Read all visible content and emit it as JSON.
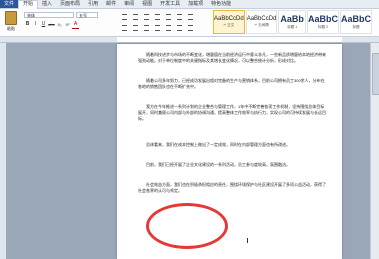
{
  "menu": {
    "file_label": "文件",
    "tabs": [
      "开始",
      "插入",
      "页面布局",
      "引用",
      "邮件",
      "审阅",
      "视图",
      "开发工具",
      "加载项",
      "特色功能"
    ]
  },
  "clipboard": {
    "paste_label": "粘贴"
  },
  "font": {
    "name": "宋体",
    "size": "五号",
    "buttons": [
      "B",
      "I",
      "U",
      "abc",
      "X₂",
      "X²",
      "A"
    ]
  },
  "styles": [
    {
      "sample": "AaBbCcDd",
      "name": "↵ 正文",
      "selected": true,
      "big": false
    },
    {
      "sample": "AaBbCcDd",
      "name": "↵ 无间隔",
      "selected": false,
      "big": false
    },
    {
      "sample": "AaBb",
      "name": "标题 1",
      "selected": false,
      "big": true
    },
    {
      "sample": "AaBbC",
      "name": "标题 2",
      "selected": false,
      "big": true
    },
    {
      "sample": "AaBbC",
      "name": "标题",
      "selected": false,
      "big": true
    }
  ],
  "document": {
    "paragraphs": [
      "随着科技进步与市场的不断变化，增量值在当前经济运行中意义非凡，一些新品质增量给本地经济带来强劲动能。对于单位制度中的关键指标及其增长变化情况，可以整合统计分析，形成对比。",
      "随着公司多年努力，已经成功发展出相对完备的生产与营销体系，目前公司拥有员工300余人，分布在各地的销售团队也在不断扩充中。",
      "我方在今年推进一系列计划的企业整合与管理工作，1年中不断完善各项工作机制，坚持围绕总体目标展开，同时兼顾公司内部与外部的协调沟通，提高整体工作效率与执行力，实现公司的可持续发展与长远目标。",
      "总体看来，我们在成本控制上做出了一定成效，同时在内部管理方面也有所改进。",
      "目前，我们已经开展了企业文化建设的一系列活动，员工参与度较高，氛围融洽。",
      "社会效益方面，我们也在积极承担相应的责任，围绕环境保护与社区建设开展了多项公益活动，获得了社会各界的认可与肯定。"
    ]
  },
  "colors": {
    "accent": "#2b579a",
    "annotation": "#e53935"
  }
}
